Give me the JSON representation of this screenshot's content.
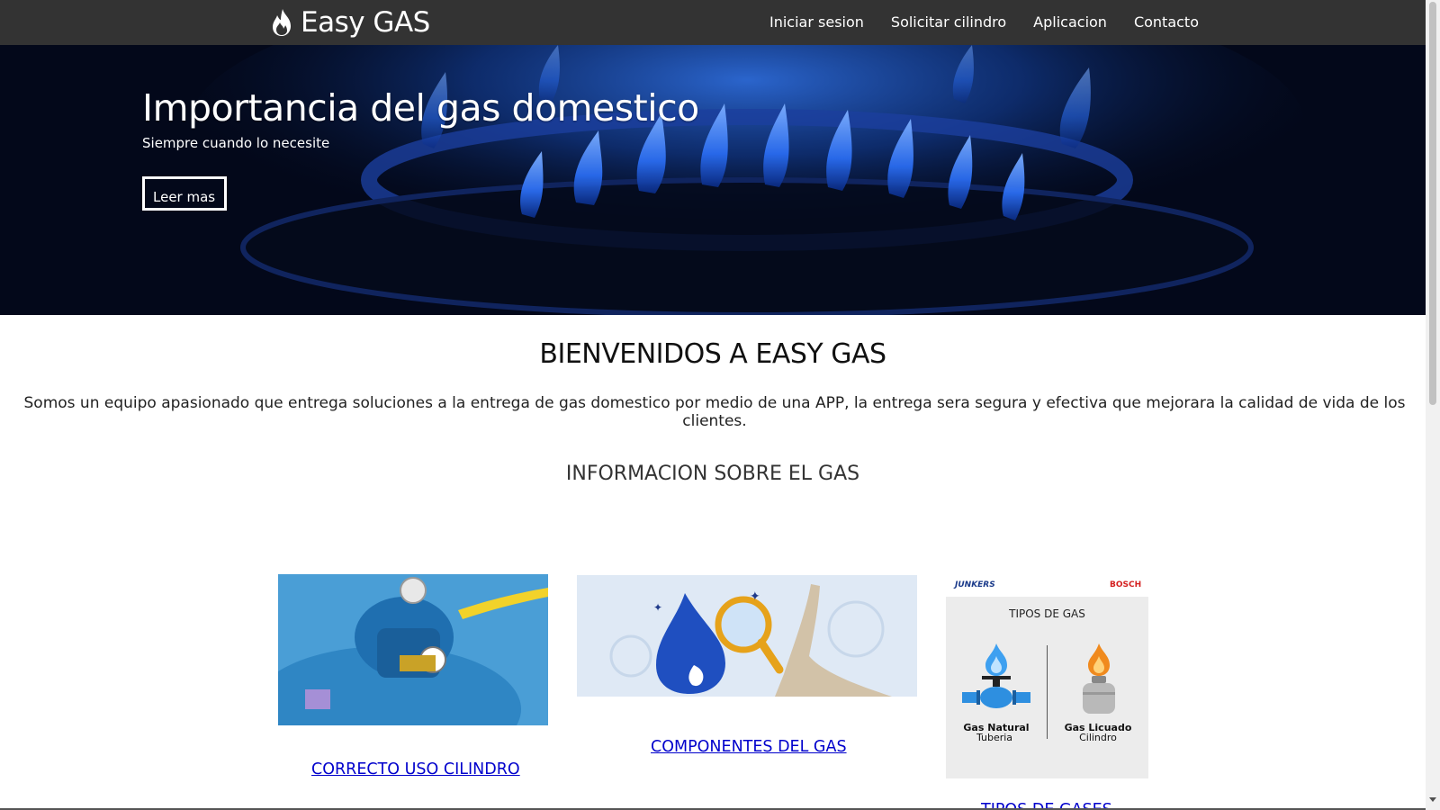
{
  "navbar": {
    "brand": "Easy GAS",
    "links": [
      "Iniciar sesion",
      "Solicitar cilindro",
      "Aplicacion",
      "Contacto"
    ]
  },
  "hero": {
    "title": "Importancia del gas domestico",
    "subtitle": "Siempre cuando lo necesite",
    "button": "Leer mas"
  },
  "welcome": {
    "title": "BIENVENIDOS A EASY GAS",
    "text": "Somos un equipo apasionado que entrega soluciones a la entrega de gas domestico por medio de una APP, la entrega sera segura y efectiva que mejorara la calidad de vida de los clientes."
  },
  "info": {
    "title": "INFORMACION SOBRE EL GAS",
    "cards": [
      {
        "link": "CORRECTO USO CILINDRO"
      },
      {
        "link": "COMPONENTES DEL GAS"
      },
      {
        "link": "TIPOS DE GASES",
        "image": {
          "brand_left": "JUNKERS",
          "brand_right": "BOSCH",
          "heading": "TIPOS DE GAS",
          "left_label": "Gas Natural",
          "left_sub": "Tuberia",
          "right_label": "Gas Licuado",
          "right_sub": "Cilindro"
        }
      }
    ]
  },
  "colors": {
    "navbar": "#333333",
    "link": "#0000cc",
    "flame_blue": "#2a6cf0"
  }
}
